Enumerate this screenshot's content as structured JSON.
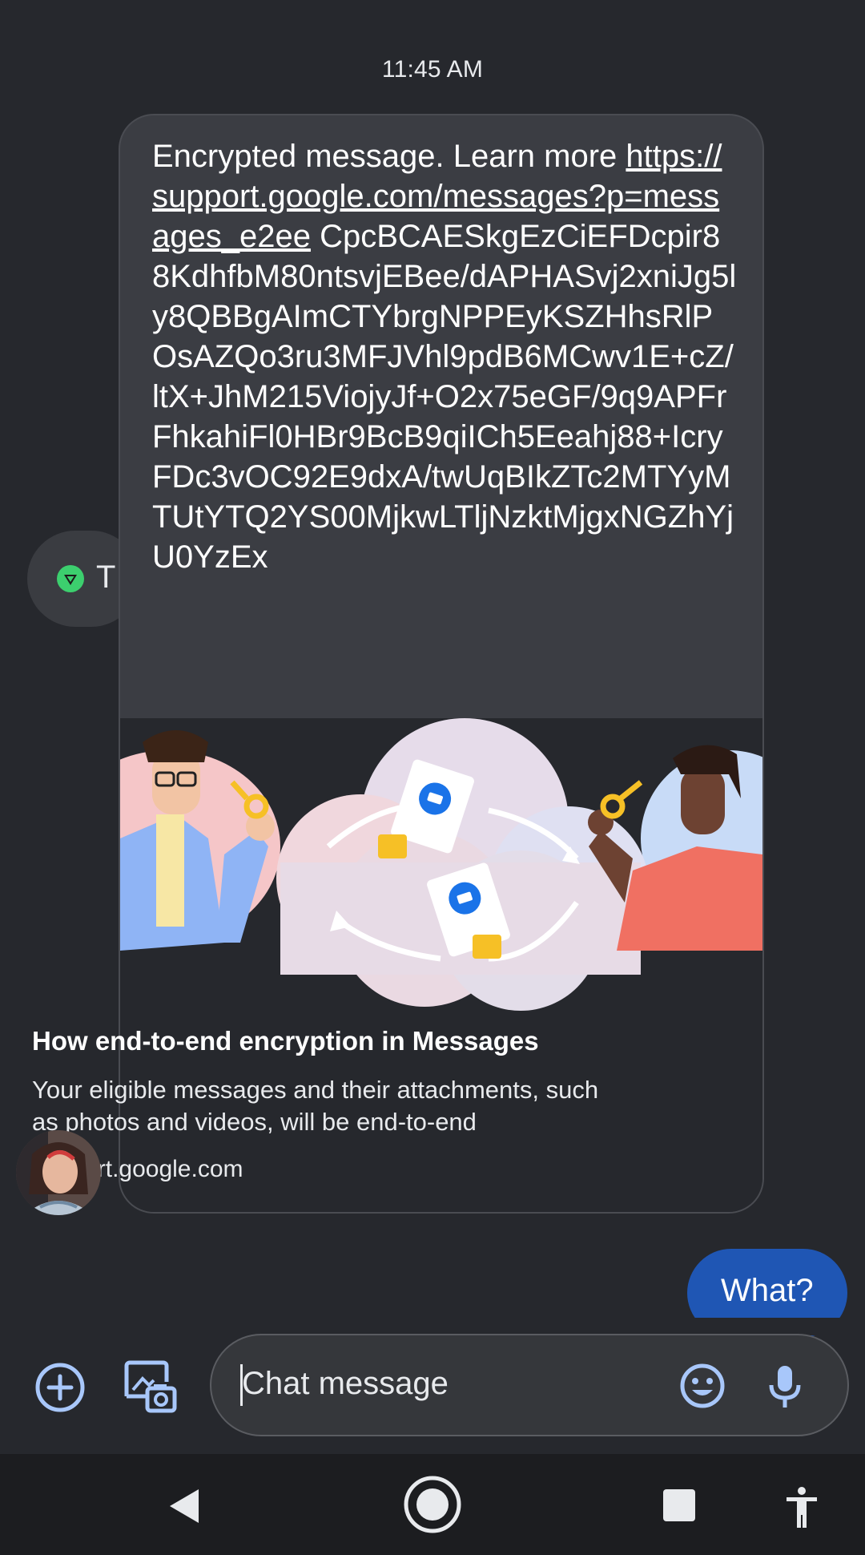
{
  "conversation": {
    "timestamp": "11:45 AM"
  },
  "incoming_message": {
    "prefix": "Encrypted message. Learn more ",
    "link": "https://support.google.com/messages?p=messages_e2ee",
    "payload": " CpcBCAESkgEzCiEFDcpir88KdhfbM80ntsvjEBee/dAPHASvj2xniJg5ly8QBBgAImCTYbrgNPPEyKSZHhsRlPOsAZQo3ru3MFJVhl9pdB6MCwv1E+cZ/ltX+JhM215ViojyJf+O2x75eGF/9q9APFrFhkahiFl0HBr9BcB9qiICh5Eeahj88+IcryFDc3vOC92E9dxA/twUqBIkZTc2MTYyMTUtYTQ2YS00MjkwLTljNzktMjgxNGZhYjU0YzEx"
  },
  "link_preview": {
    "title": "How end-to-end encryption in Messages",
    "description": "Your eligible messages and their attachments, such as photos and videos, will be end-to-end",
    "domain": "support.google.com",
    "image_icon": "encryption-illustration"
  },
  "reaction": {
    "icon": "green-triangle-emoji",
    "label": "T"
  },
  "sender": {
    "avatar_icon": "contact-photo"
  },
  "outgoing_message": {
    "text": "What?"
  },
  "composer": {
    "placeholder": "Chat message",
    "add_icon": "plus-circle-icon",
    "gallery_icon": "gallery-camera-icon",
    "emoji_icon": "emoji-icon",
    "mic_icon": "mic-icon"
  },
  "system_nav": {
    "back": "back-icon",
    "home": "home-icon",
    "recents": "recents-icon",
    "accessibility": "accessibility-icon"
  },
  "colors": {
    "background": "#26282d",
    "incoming_bubble": "#3b3d43",
    "outgoing_bubble": "#1f56b4",
    "accent": "#a8c7fa"
  }
}
